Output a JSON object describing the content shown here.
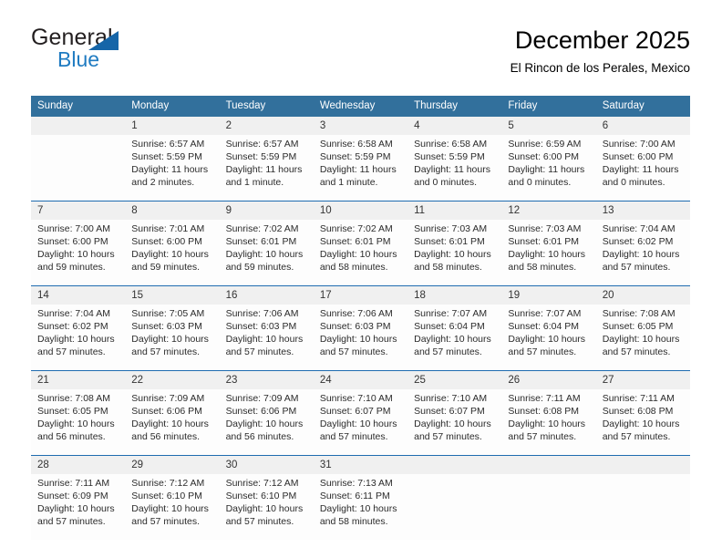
{
  "brand": {
    "word_general": "General",
    "word_blue": "Blue",
    "logo_icon": "triangle-flag-icon"
  },
  "header": {
    "title": "December 2025",
    "subtitle": "El Rincon de los Perales, Mexico"
  },
  "colors": {
    "header_blue": "#32709c",
    "separator_blue": "#1f6cb0",
    "daynum_band": "#f0f0f0",
    "brand_blue": "#1f7bc1",
    "logo_triangle": "#1565a8",
    "text": "#2b2b2b"
  },
  "calendar": {
    "weekday_headers": [
      "Sunday",
      "Monday",
      "Tuesday",
      "Wednesday",
      "Thursday",
      "Friday",
      "Saturday"
    ],
    "weeks": [
      [
        {
          "day": "",
          "sunrise": "",
          "sunset": "",
          "daylight_1": "",
          "daylight_2": ""
        },
        {
          "day": "1",
          "sunrise": "Sunrise: 6:57 AM",
          "sunset": "Sunset: 5:59 PM",
          "daylight_1": "Daylight: 11 hours",
          "daylight_2": "and 2 minutes."
        },
        {
          "day": "2",
          "sunrise": "Sunrise: 6:57 AM",
          "sunset": "Sunset: 5:59 PM",
          "daylight_1": "Daylight: 11 hours",
          "daylight_2": "and 1 minute."
        },
        {
          "day": "3",
          "sunrise": "Sunrise: 6:58 AM",
          "sunset": "Sunset: 5:59 PM",
          "daylight_1": "Daylight: 11 hours",
          "daylight_2": "and 1 minute."
        },
        {
          "day": "4",
          "sunrise": "Sunrise: 6:58 AM",
          "sunset": "Sunset: 5:59 PM",
          "daylight_1": "Daylight: 11 hours",
          "daylight_2": "and 0 minutes."
        },
        {
          "day": "5",
          "sunrise": "Sunrise: 6:59 AM",
          "sunset": "Sunset: 6:00 PM",
          "daylight_1": "Daylight: 11 hours",
          "daylight_2": "and 0 minutes."
        },
        {
          "day": "6",
          "sunrise": "Sunrise: 7:00 AM",
          "sunset": "Sunset: 6:00 PM",
          "daylight_1": "Daylight: 11 hours",
          "daylight_2": "and 0 minutes."
        }
      ],
      [
        {
          "day": "7",
          "sunrise": "Sunrise: 7:00 AM",
          "sunset": "Sunset: 6:00 PM",
          "daylight_1": "Daylight: 10 hours",
          "daylight_2": "and 59 minutes."
        },
        {
          "day": "8",
          "sunrise": "Sunrise: 7:01 AM",
          "sunset": "Sunset: 6:00 PM",
          "daylight_1": "Daylight: 10 hours",
          "daylight_2": "and 59 minutes."
        },
        {
          "day": "9",
          "sunrise": "Sunrise: 7:02 AM",
          "sunset": "Sunset: 6:01 PM",
          "daylight_1": "Daylight: 10 hours",
          "daylight_2": "and 59 minutes."
        },
        {
          "day": "10",
          "sunrise": "Sunrise: 7:02 AM",
          "sunset": "Sunset: 6:01 PM",
          "daylight_1": "Daylight: 10 hours",
          "daylight_2": "and 58 minutes."
        },
        {
          "day": "11",
          "sunrise": "Sunrise: 7:03 AM",
          "sunset": "Sunset: 6:01 PM",
          "daylight_1": "Daylight: 10 hours",
          "daylight_2": "and 58 minutes."
        },
        {
          "day": "12",
          "sunrise": "Sunrise: 7:03 AM",
          "sunset": "Sunset: 6:01 PM",
          "daylight_1": "Daylight: 10 hours",
          "daylight_2": "and 58 minutes."
        },
        {
          "day": "13",
          "sunrise": "Sunrise: 7:04 AM",
          "sunset": "Sunset: 6:02 PM",
          "daylight_1": "Daylight: 10 hours",
          "daylight_2": "and 57 minutes."
        }
      ],
      [
        {
          "day": "14",
          "sunrise": "Sunrise: 7:04 AM",
          "sunset": "Sunset: 6:02 PM",
          "daylight_1": "Daylight: 10 hours",
          "daylight_2": "and 57 minutes."
        },
        {
          "day": "15",
          "sunrise": "Sunrise: 7:05 AM",
          "sunset": "Sunset: 6:03 PM",
          "daylight_1": "Daylight: 10 hours",
          "daylight_2": "and 57 minutes."
        },
        {
          "day": "16",
          "sunrise": "Sunrise: 7:06 AM",
          "sunset": "Sunset: 6:03 PM",
          "daylight_1": "Daylight: 10 hours",
          "daylight_2": "and 57 minutes."
        },
        {
          "day": "17",
          "sunrise": "Sunrise: 7:06 AM",
          "sunset": "Sunset: 6:03 PM",
          "daylight_1": "Daylight: 10 hours",
          "daylight_2": "and 57 minutes."
        },
        {
          "day": "18",
          "sunrise": "Sunrise: 7:07 AM",
          "sunset": "Sunset: 6:04 PM",
          "daylight_1": "Daylight: 10 hours",
          "daylight_2": "and 57 minutes."
        },
        {
          "day": "19",
          "sunrise": "Sunrise: 7:07 AM",
          "sunset": "Sunset: 6:04 PM",
          "daylight_1": "Daylight: 10 hours",
          "daylight_2": "and 57 minutes."
        },
        {
          "day": "20",
          "sunrise": "Sunrise: 7:08 AM",
          "sunset": "Sunset: 6:05 PM",
          "daylight_1": "Daylight: 10 hours",
          "daylight_2": "and 57 minutes."
        }
      ],
      [
        {
          "day": "21",
          "sunrise": "Sunrise: 7:08 AM",
          "sunset": "Sunset: 6:05 PM",
          "daylight_1": "Daylight: 10 hours",
          "daylight_2": "and 56 minutes."
        },
        {
          "day": "22",
          "sunrise": "Sunrise: 7:09 AM",
          "sunset": "Sunset: 6:06 PM",
          "daylight_1": "Daylight: 10 hours",
          "daylight_2": "and 56 minutes."
        },
        {
          "day": "23",
          "sunrise": "Sunrise: 7:09 AM",
          "sunset": "Sunset: 6:06 PM",
          "daylight_1": "Daylight: 10 hours",
          "daylight_2": "and 56 minutes."
        },
        {
          "day": "24",
          "sunrise": "Sunrise: 7:10 AM",
          "sunset": "Sunset: 6:07 PM",
          "daylight_1": "Daylight: 10 hours",
          "daylight_2": "and 57 minutes."
        },
        {
          "day": "25",
          "sunrise": "Sunrise: 7:10 AM",
          "sunset": "Sunset: 6:07 PM",
          "daylight_1": "Daylight: 10 hours",
          "daylight_2": "and 57 minutes."
        },
        {
          "day": "26",
          "sunrise": "Sunrise: 7:11 AM",
          "sunset": "Sunset: 6:08 PM",
          "daylight_1": "Daylight: 10 hours",
          "daylight_2": "and 57 minutes."
        },
        {
          "day": "27",
          "sunrise": "Sunrise: 7:11 AM",
          "sunset": "Sunset: 6:08 PM",
          "daylight_1": "Daylight: 10 hours",
          "daylight_2": "and 57 minutes."
        }
      ],
      [
        {
          "day": "28",
          "sunrise": "Sunrise: 7:11 AM",
          "sunset": "Sunset: 6:09 PM",
          "daylight_1": "Daylight: 10 hours",
          "daylight_2": "and 57 minutes."
        },
        {
          "day": "29",
          "sunrise": "Sunrise: 7:12 AM",
          "sunset": "Sunset: 6:10 PM",
          "daylight_1": "Daylight: 10 hours",
          "daylight_2": "and 57 minutes."
        },
        {
          "day": "30",
          "sunrise": "Sunrise: 7:12 AM",
          "sunset": "Sunset: 6:10 PM",
          "daylight_1": "Daylight: 10 hours",
          "daylight_2": "and 57 minutes."
        },
        {
          "day": "31",
          "sunrise": "Sunrise: 7:13 AM",
          "sunset": "Sunset: 6:11 PM",
          "daylight_1": "Daylight: 10 hours",
          "daylight_2": "and 58 minutes."
        },
        {
          "day": "",
          "sunrise": "",
          "sunset": "",
          "daylight_1": "",
          "daylight_2": ""
        },
        {
          "day": "",
          "sunrise": "",
          "sunset": "",
          "daylight_1": "",
          "daylight_2": ""
        },
        {
          "day": "",
          "sunrise": "",
          "sunset": "",
          "daylight_1": "",
          "daylight_2": ""
        }
      ]
    ]
  }
}
